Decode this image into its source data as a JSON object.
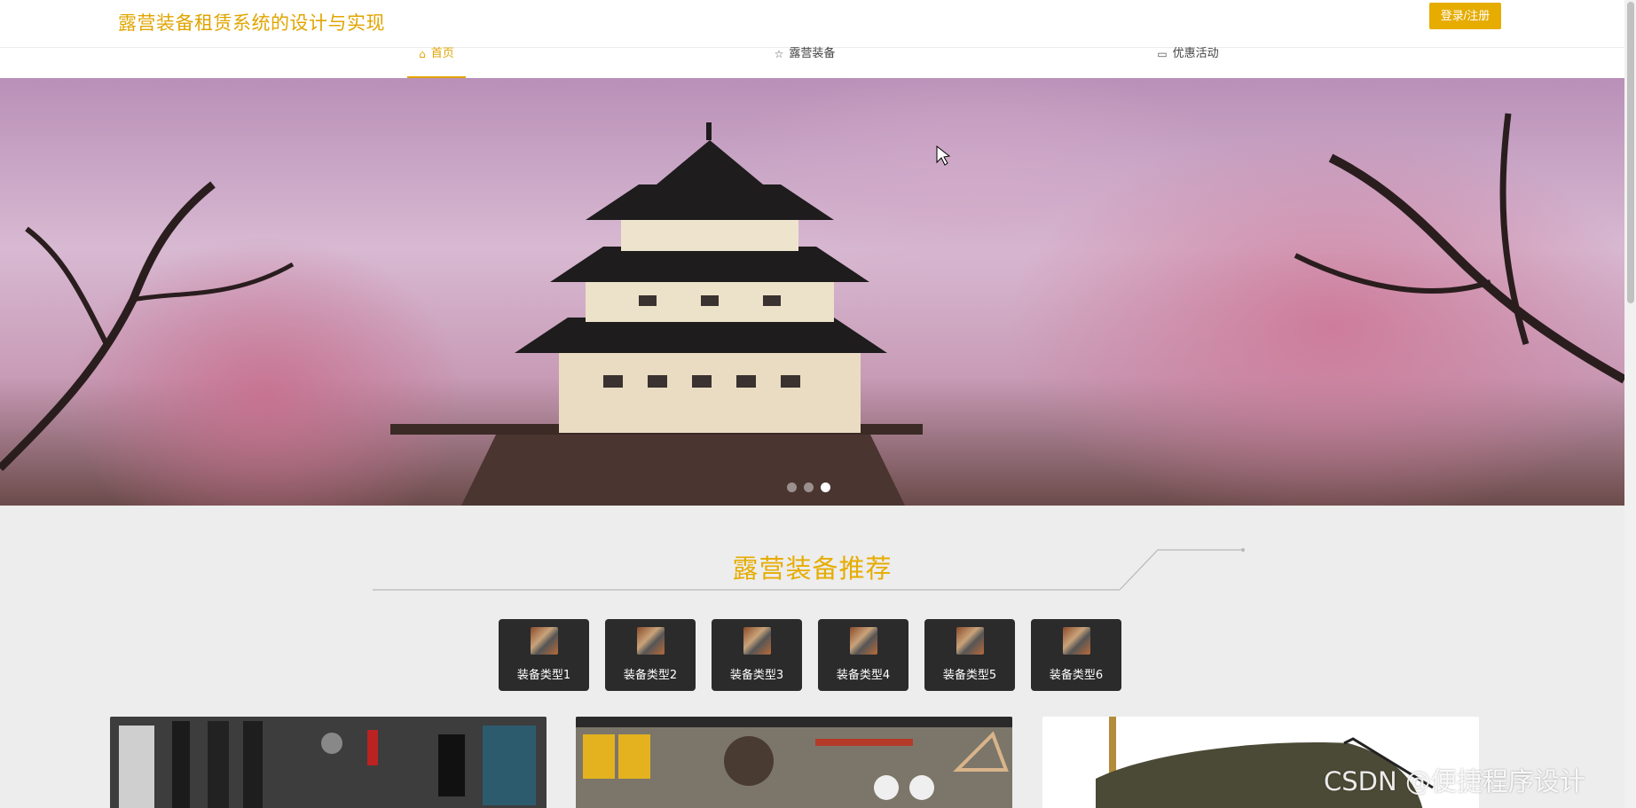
{
  "header": {
    "site_title": "露营装备租赁系统的设计与实现",
    "login_label": "登录/注册"
  },
  "nav": {
    "items": [
      {
        "label": "首页",
        "icon": "home-icon",
        "active": true
      },
      {
        "label": "露营装备",
        "icon": "star-icon",
        "active": false
      },
      {
        "label": "优惠活动",
        "icon": "calendar-icon",
        "active": false
      }
    ]
  },
  "banner": {
    "slide_count": 3,
    "active_slide": 3
  },
  "section": {
    "title": "露营装备推荐"
  },
  "categories": [
    {
      "label": "装备类型1"
    },
    {
      "label": "装备类型2"
    },
    {
      "label": "装备类型3"
    },
    {
      "label": "装备类型4"
    },
    {
      "label": "装备类型5"
    },
    {
      "label": "装备类型6"
    }
  ],
  "watermark": "CSDN @便捷程序设计",
  "colors": {
    "accent": "#e6ac00",
    "category_bg": "#2b2b2b",
    "page_bg": "#ededed"
  }
}
